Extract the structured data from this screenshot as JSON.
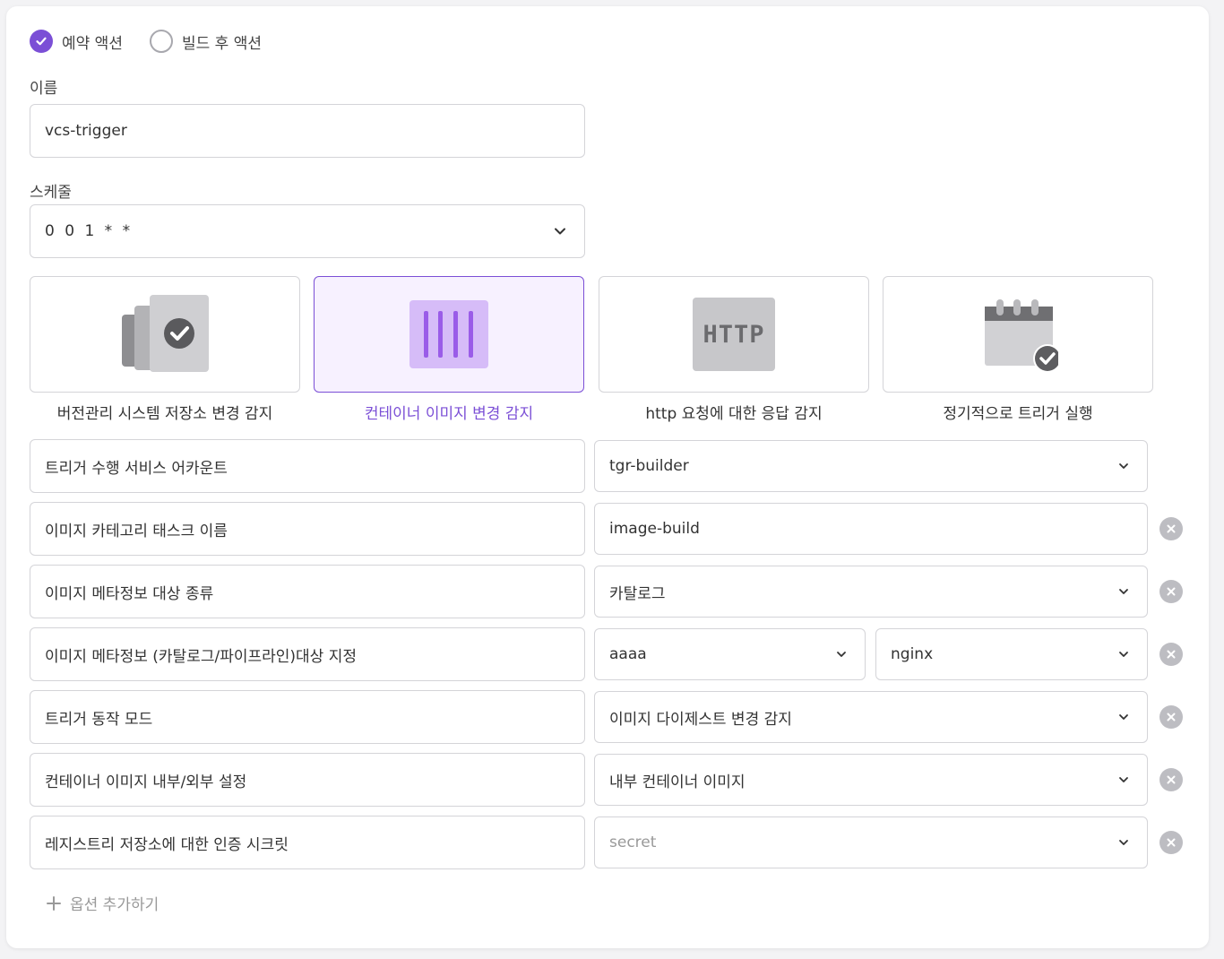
{
  "action_type": {
    "options": [
      "예약 액션",
      "빌드 후 액션"
    ],
    "selected": "예약 액션"
  },
  "name_field": {
    "label": "이름",
    "value": "vcs-trigger"
  },
  "schedule_field": {
    "label": "스케줄",
    "value": "0 0 1 * *"
  },
  "trigger_types": [
    {
      "label": "버전관리 시스템 저장소 변경 감지",
      "icon": "vcs-repo-check-icon",
      "selected": false
    },
    {
      "label": "컨테이너 이미지 변경 감지",
      "icon": "container-image-icon",
      "selected": true
    },
    {
      "label": "http 요청에 대한 응답 감지",
      "icon": "http-icon",
      "icon_text": "HTTP",
      "selected": false
    },
    {
      "label": "정기적으로 트리거 실행",
      "icon": "calendar-check-icon",
      "selected": false
    }
  ],
  "options": [
    {
      "label": "트리거 수행 서비스 어카운트",
      "value": "tgr-builder",
      "control": "select",
      "removable": false
    },
    {
      "label": "이미지 카테고리 태스크 이름",
      "value": "image-build",
      "control": "input",
      "removable": true
    },
    {
      "label": "이미지 메타정보 대상 종류",
      "value": "카탈로그",
      "control": "select",
      "removable": true
    },
    {
      "label": "이미지 메타정보 (카탈로그/파이프라인)대상 지정",
      "value": "aaaa",
      "value2": "nginx",
      "control": "select-pair",
      "removable": true
    },
    {
      "label": "트리거 동작 모드",
      "value": "이미지 다이제스트 변경 감지",
      "control": "select",
      "removable": true
    },
    {
      "label": "컨테이너 이미지 내부/외부 설정",
      "value": "내부 컨테이너 이미지",
      "control": "select",
      "removable": true
    },
    {
      "label": "레지스트리 저장소에 대한 인증 시크릿",
      "placeholder": "secret",
      "control": "select",
      "removable": true
    }
  ],
  "add_option_label": "옵션 추가하기",
  "colors": {
    "accent": "#7b4fd6",
    "border": "#d4d4d8",
    "muted": "#999999"
  }
}
